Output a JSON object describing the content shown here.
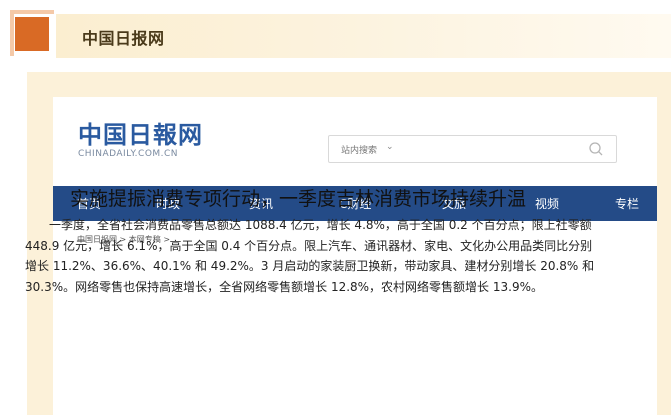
{
  "header": {
    "title": "中国日报网"
  },
  "site": {
    "logo_cn": "中国日報网",
    "logo_en": "CHINADAILY.COM.CN"
  },
  "search": {
    "placeholder": "站内搜索",
    "chevron": "⌄"
  },
  "nav": {
    "items": [
      "首页",
      "时政",
      "资讯",
      "C财经",
      "文旅",
      "视频",
      "专栏"
    ]
  },
  "breadcrumb": "中国日报网 > 本网专稿 >",
  "article": {
    "title": "实施提振消费专项行动，一季度吉林消费市场持续升温",
    "body": "一季度，全省社会消费品零售总额达 1088.4 亿元，增长 4.8%，高于全国 0.2 个百分点；限上社零额 448.9 亿元，增长 6.1%，高于全国 0.4 个百分点。限上汽车、通讯器材、家电、文化办公用品类同比分别增长 11.2%、36.6%、40.1% 和 49.2%。3 月启动的家装厨卫换新，带动家具、建材分别增长 20.8% 和 30.3%。网络零售也保持高速增长，全省网络零售额增长 12.8%，农村网络零售额增长 13.9%。"
  },
  "colors": {
    "accent": "#d96a25",
    "nav": "#244b87",
    "frame": "#fcf1d9"
  }
}
